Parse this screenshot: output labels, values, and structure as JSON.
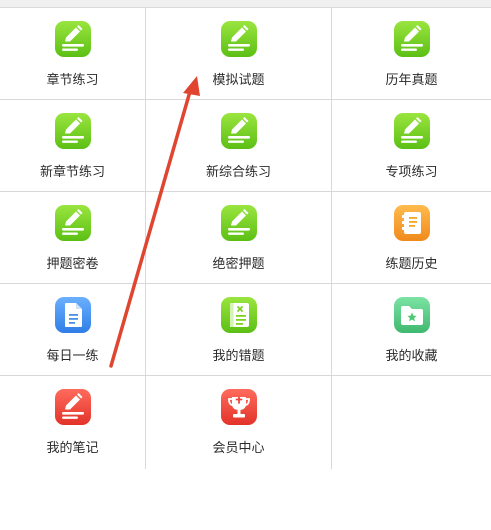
{
  "colors": {
    "green": "#7ed321",
    "orange": "#f5a623",
    "blue": "#4a90e2",
    "teal": "#50c878",
    "red": "#f0453a",
    "arrow": "#e0452f"
  },
  "grid": {
    "rows": [
      [
        {
          "label": "章节练习",
          "icon": "pencil-icon",
          "color": "green"
        },
        {
          "label": "模拟试题",
          "icon": "pencil-icon",
          "color": "green"
        },
        {
          "label": "历年真题",
          "icon": "pencil-icon",
          "color": "green"
        }
      ],
      [
        {
          "label": "新章节练习",
          "icon": "pencil-icon",
          "color": "green"
        },
        {
          "label": "新综合练习",
          "icon": "pencil-icon",
          "color": "green"
        },
        {
          "label": "专项练习",
          "icon": "pencil-icon",
          "color": "green"
        }
      ],
      [
        {
          "label": "押题密卷",
          "icon": "pencil-icon",
          "color": "green"
        },
        {
          "label": "绝密押题",
          "icon": "pencil-icon",
          "color": "green"
        },
        {
          "label": "练题历史",
          "icon": "history-book-icon",
          "color": "orange"
        }
      ],
      [
        {
          "label": "每日一练",
          "icon": "document-icon",
          "color": "blue"
        },
        {
          "label": "我的错题",
          "icon": "error-book-icon",
          "color": "green"
        },
        {
          "label": "我的收藏",
          "icon": "star-folder-icon",
          "color": "teal"
        }
      ],
      [
        {
          "label": "我的笔记",
          "icon": "pencil-icon",
          "color": "red"
        },
        {
          "label": "会员中心",
          "icon": "trophy-icon",
          "color": "red"
        }
      ]
    ]
  }
}
